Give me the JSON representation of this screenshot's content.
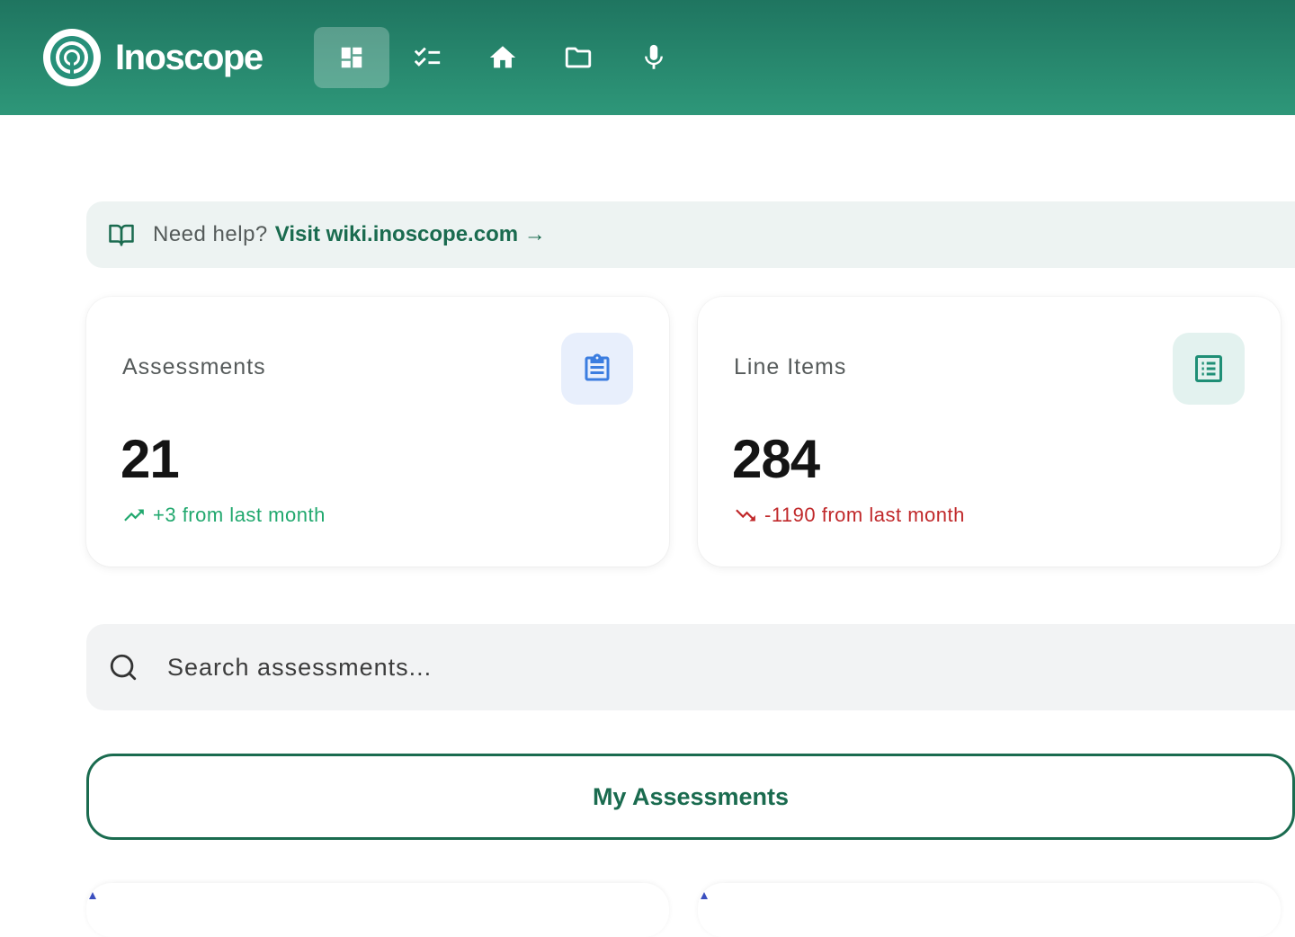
{
  "header": {
    "logo_text": "Inoscope",
    "nav": [
      {
        "icon": "dashboard-icon",
        "active": true
      },
      {
        "icon": "checklist-icon",
        "active": false
      },
      {
        "icon": "home-icon",
        "active": false
      },
      {
        "icon": "folder-icon",
        "active": false
      },
      {
        "icon": "microphone-icon",
        "active": false
      }
    ]
  },
  "help": {
    "icon": "book-icon",
    "question": "Need help?",
    "link_text": "Visit wiki.inoscope.com →"
  },
  "stats": [
    {
      "label": "Assessments",
      "value": "21",
      "trend": "+3 from last month",
      "direction": "up",
      "icon": "clipboard-icon",
      "icon_color": "#3b7de0"
    },
    {
      "label": "Line Items",
      "value": "284",
      "trend": "-1190 from last month",
      "direction": "down",
      "icon": "list-icon",
      "icon_color": "#1f8f76"
    }
  ],
  "search": {
    "placeholder": "Search assessments..."
  },
  "my_assessments_label": "My Assessments",
  "colors": {
    "brand": "#1a6b4f",
    "trend_up": "#21a86e",
    "trend_down": "#c0282a"
  }
}
